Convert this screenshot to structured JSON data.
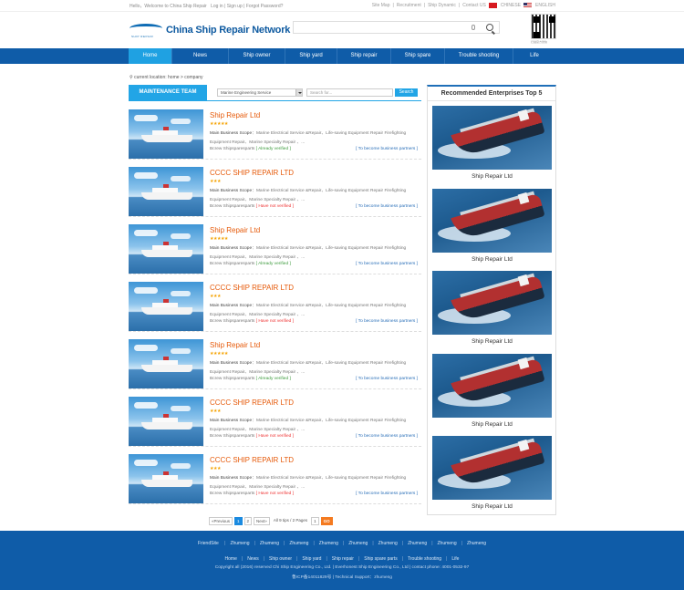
{
  "topbar": {
    "greeting": "Hello，Welcome to China Ship Repair",
    "login": "Log in",
    "signup": "Sign up",
    "forgot": "Forgot Password?",
    "links": [
      "Site Map",
      "Recruitment",
      "Ship Dynamic",
      "Contact US"
    ],
    "lang_cn": "CHINESE",
    "lang_en": "ENGLISH"
  },
  "header": {
    "logo_title": "China Ship Repair Network",
    "logo_sub": "SHIP REPAIR",
    "qr_caption": "扫描官方微信"
  },
  "nav": [
    "Home",
    "News",
    "Ship owner",
    "Ship yard",
    "Ship repair",
    "Ship spare",
    "Trouble shooting",
    "Life"
  ],
  "breadcrumb": "current location: home > company",
  "filter": {
    "tab": "MAINTENANCE TEAM",
    "select_value": "Marine Engineering  Service",
    "search_placeholder": "Search for...",
    "search_button": "Search"
  },
  "listings": [
    {
      "title": "Ship Repair Ltd",
      "stars": "★★★★★",
      "scope_label": "Main Business Scope",
      "scope": "：Marine Electrical Service &Repair、Life-saving  Equipment Repair Firefighting Equipment Repair、Marine  Specialty  Repair  、...",
      "brand": "Bcrew Shipsparesparts",
      "status": "[ Already verified ]",
      "verified": true,
      "partner": "[ To become business partners ]"
    },
    {
      "title": "CCCC SHIP REPAIR LTD",
      "stars": "★★★",
      "scope_label": "Main Business Scope",
      "scope": "：Marine Electrical Service &Repair、Life-saving  Equipment Repair Firefighting Equipment Repair、Marine  Specialty  Repair  、...",
      "brand": "Bcrew Shipsparesparts",
      "status": "[ Have not verified ]",
      "verified": false,
      "partner": "[ To become business partners ]"
    },
    {
      "title": "Ship Repair Ltd",
      "stars": "★★★★★",
      "scope_label": "Main Business Scope",
      "scope": "：Marine Electrical Service &Repair、Life-saving  Equipment Repair Firefighting Equipment Repair、Marine  Specialty  Repair  、...",
      "brand": "Bcrew Shipsparesparts",
      "status": "[ Already verified ]",
      "verified": true,
      "partner": "[ To become business partners ]"
    },
    {
      "title": "CCCC SHIP REPAIR LTD",
      "stars": "★★★",
      "scope_label": "Main Business Scope",
      "scope": "：Marine Electrical Service &Repair、Life-saving  Equipment Repair Firefighting Equipment Repair、Marine  Specialty  Repair  、...",
      "brand": "Bcrew Shipsparesparts",
      "status": "[ Have not verified ]",
      "verified": false,
      "partner": "[ To become business partners ]"
    },
    {
      "title": "Ship Repair Ltd",
      "stars": "★★★★★",
      "scope_label": "Main Business Scope",
      "scope": "：Marine Electrical Service &Repair、Life-saving  Equipment Repair Firefighting Equipment Repair、Marine  Specialty  Repair  、...",
      "brand": "Bcrew Shipsparesparts",
      "status": "[ Already verified ]",
      "verified": true,
      "partner": "[ To become business partners ]"
    },
    {
      "title": "CCCC SHIP REPAIR LTD",
      "stars": "★★★",
      "scope_label": "Main Business Scope",
      "scope": "：Marine Electrical Service &Repair、Life-saving  Equipment Repair Firefighting Equipment Repair、Marine  Specialty  Repair  、...",
      "brand": "Bcrew Shipsparesparts",
      "status": "[ Have not verified ]",
      "verified": false,
      "partner": "[ To become business partners ]"
    },
    {
      "title": "CCCC SHIP REPAIR LTD",
      "stars": "★★★",
      "scope_label": "Main Business Scope",
      "scope": "：Marine Electrical Service &Repair、Life-saving  Equipment Repair Firefighting Equipment Repair、Marine  Specialty  Repair  、...",
      "brand": "Bcrew Shipsparesparts",
      "status": "[ Have not verified ]",
      "verified": false,
      "partner": "[ To become business partners ]"
    }
  ],
  "pager": {
    "prev": "«Previous",
    "pages": [
      "1",
      "2"
    ],
    "next": "Next»",
    "info": "All 9 tips / 2 Pages",
    "jump": "1",
    "go": "GO"
  },
  "sidebar": {
    "title": "Recommended Enterprises Top 5",
    "items": [
      "Ship Repair Ltd",
      "Ship Repair Ltd",
      "Ship Repair Ltd",
      "Ship Repair Ltd",
      "Ship Repair Ltd"
    ]
  },
  "footer": {
    "friendsite_label": "FriendSite",
    "friendsites": [
      "Zhumeng",
      "Zhumeng",
      "Zhumeng",
      "Zhumeng",
      "Zhumeng",
      "Zhumeng",
      "Zhumeng",
      "Zhumeng",
      "Zhumeng"
    ],
    "nav": [
      "Home",
      "News",
      "Ship owner",
      "Ship yard",
      "Ship repair",
      "Ship spare parts",
      "Trouble shooting",
      "Life"
    ],
    "copyright": "Copyright all (2016) reserved Chi Ship Engineering Co., Ltd. | Everhonest Ship Engineering Co., Ltd | contact phone: 4001-0532-97",
    "icp": "鲁ICP备14011829号 | Technical Support：zhumeng"
  },
  "colors": {
    "nav": "#0f5ca8",
    "accent": "#22a5e6",
    "title": "#e65a0a",
    "go": "#f47a20"
  }
}
